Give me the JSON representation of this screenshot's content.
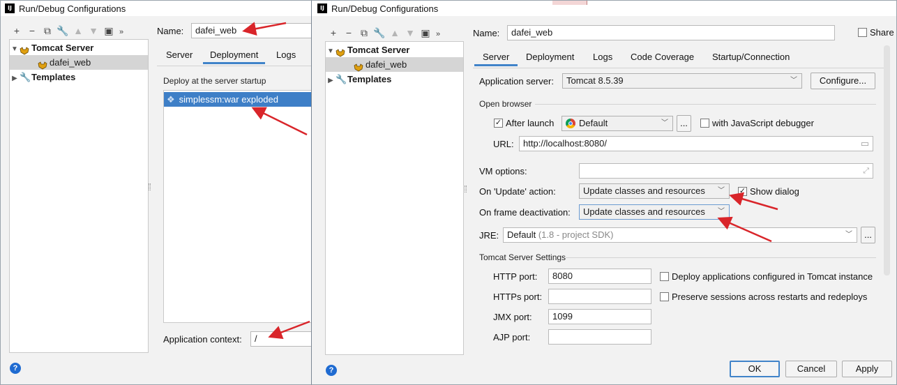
{
  "back_window": {
    "title": "Run/Debug Configurations",
    "name_label": "Name:",
    "name_value": "dafei_web",
    "tree": {
      "tomcat_label": "Tomcat Server",
      "config_label": "dafei_web",
      "templates_label": "Templates"
    },
    "tabs": [
      "Server",
      "Deployment",
      "Logs"
    ],
    "deploy_section": "Deploy at the server startup",
    "artifact": "simplessm:war exploded",
    "app_context_label": "Application context:",
    "app_context_value": "/"
  },
  "front_window": {
    "title": "Run/Debug Configurations",
    "name_label": "Name:",
    "name_value": "dafei_web",
    "share_label": "Share",
    "tree": {
      "tomcat_label": "Tomcat Server",
      "config_label": "dafei_web",
      "templates_label": "Templates"
    },
    "tabs": [
      "Server",
      "Deployment",
      "Logs",
      "Code Coverage",
      "Startup/Connection"
    ],
    "app_server_label": "Application server:",
    "app_server_value": "Tomcat 8.5.39",
    "configure_button": "Configure...",
    "open_browser_section": "Open browser",
    "after_launch_label": "After launch",
    "browser_value": "Default",
    "browse_button": "...",
    "js_debugger_label": "with JavaScript debugger",
    "url_label": "URL:",
    "url_value": "http://localhost:8080/",
    "vm_options_label": "VM options:",
    "on_update_label": "On 'Update' action:",
    "on_update_value": "Update classes and resources",
    "show_dialog_label": "Show dialog",
    "on_frame_label": "On frame deactivation:",
    "on_frame_value": "Update classes and resources",
    "jre_label": "JRE:",
    "jre_value": "Default",
    "jre_hint": "(1.8 - project SDK)",
    "jre_button": "...",
    "tomcat_settings_section": "Tomcat Server Settings",
    "http_port_label": "HTTP port:",
    "http_port_value": "8080",
    "https_port_label": "HTTPs port:",
    "https_port_value": "",
    "jmx_port_label": "JMX port:",
    "jmx_port_value": "1099",
    "ajp_port_label": "AJP port:",
    "ajp_port_value": "",
    "deploy_apps_label": "Deploy applications configured in Tomcat instance",
    "preserve_sessions_label": "Preserve sessions across restarts and redeploys",
    "ok_button": "OK",
    "cancel_button": "Cancel",
    "apply_button": "Apply"
  },
  "toolbar_icons": [
    "add-icon",
    "remove-icon",
    "copy-icon",
    "wrench-icon",
    "move-up-icon",
    "move-down-icon",
    "folder-icon",
    "more-icon"
  ],
  "colors": {
    "accent": "#4083c9",
    "selection": "#3e7fc7",
    "arrow": "#d9252a",
    "help": "#1f6bd1"
  },
  "icons": {
    "help": "?"
  }
}
